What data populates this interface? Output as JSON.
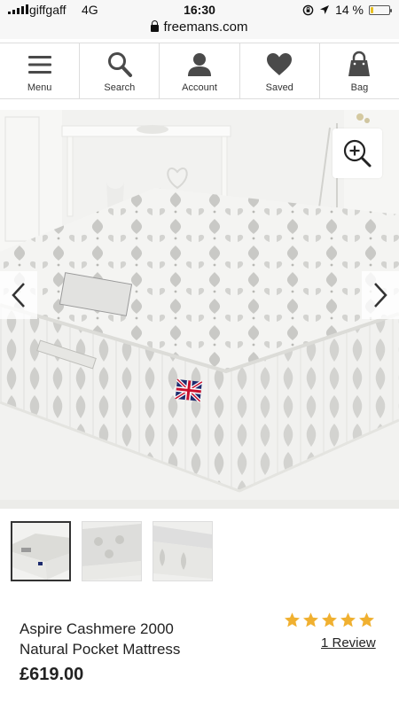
{
  "status_bar": {
    "carrier": "giffgaff",
    "network": "4G",
    "time": "16:30",
    "battery": "14 %",
    "battery_level": 0.14
  },
  "browser": {
    "url": "freemans.com"
  },
  "nav": {
    "items": [
      {
        "label": "Menu",
        "icon": "menu-icon"
      },
      {
        "label": "Search",
        "icon": "search-icon"
      },
      {
        "label": "Account",
        "icon": "account-icon"
      },
      {
        "label": "Saved",
        "icon": "heart-icon"
      },
      {
        "label": "Bag",
        "icon": "bag-icon"
      }
    ]
  },
  "product": {
    "title_line1": "Aspire Cashmere 2000",
    "title_line2": "Natural Pocket Mattress",
    "price": "£619.00",
    "rating": 5,
    "rating_max": 5,
    "review_link": "1 Review",
    "thumbnail_count": 3
  },
  "colors": {
    "star": "#f0b030",
    "text": "#222222",
    "icon": "#4a4a4a"
  }
}
